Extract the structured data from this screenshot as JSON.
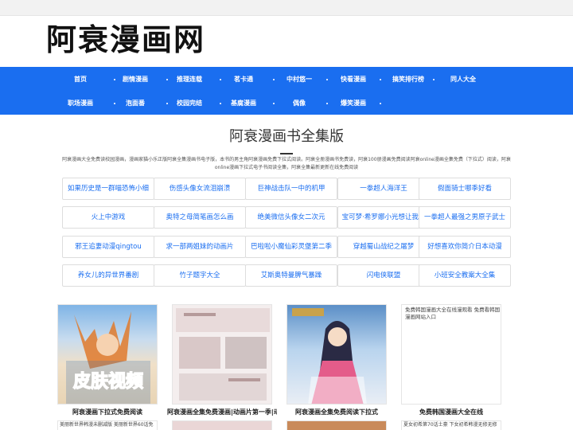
{
  "site": {
    "logo_text": "阿衰漫画网"
  },
  "nav": {
    "row1": [
      "首页",
      "剧情漫画",
      "推理连载",
      "茗卡通",
      "中村悠一",
      "快看漫画",
      "搞笑排行榜",
      "同人大全"
    ],
    "row2": [
      "职场漫画",
      "泡面番",
      "校园完结",
      "基腐漫画",
      "偶像",
      "爆笑漫画"
    ]
  },
  "hero": {
    "title": "阿衰漫画书全集版",
    "description": "阿衰漫画大全免费读校园漫画，漫画家猫小乐正版阿衰全集漫画书电子版，本书的男主角阿衰漫画免费下拉式阅读。阿衰全册漫画书免费读，阿衰100册漫画免费阅读阿衰online漫画全集免费（下拉式）阅读，阿衰online漫画下拉式电子书阅读全集，阿衰全集最新更新在线免费阅读"
  },
  "tags": [
    "如果历史是一群喵恐怖小细",
    "伤感头像女流泪崩溃",
    "巨神战击队一中的机甲",
    "一拳超人海洋王",
    "假面骑士哪季好看",
    "火上中游戏",
    "奥特之母简笔画怎么画",
    "绝美微信头像女二次元",
    "宝可梦·希罗娜小光想让我告",
    "一拳超人最强之男原子武士",
    "邪王追妻动漫qingtou",
    "求一部两姐妹的动画片",
    "巴啦啦小魔仙彩灵堡第二季",
    "穿越蜀山战纪之屠梦",
    "好想喜欢你简介日本动漫",
    "养女儿的异世界番剧",
    "竹子题字大全",
    "艾斯奥特曼脾气暴躁",
    "闪电侠联盟",
    "小班安全教案大全集"
  ],
  "cards": [
    {
      "title": "阿衰漫画下拉式免费阅读",
      "image_text": "皮肤视频"
    },
    {
      "title": "阿衰漫画全集免费漫画|动画片第一季|动…",
      "image_text": ""
    },
    {
      "title": "阿衰漫画全集免费阅读下拉式",
      "image_text": ""
    },
    {
      "title": "免费韩国漫画大全在线",
      "image_alt": "免费韩国漫画大全在线漫观看 免费看韩国漫画网站入口"
    }
  ],
  "cards_row2": [
    "美丽新世界韩漫未删减版 美丽新世界60话免",
    "",
    "",
    "夏女初希第70话土豪 下女初希韩漫无修无修"
  ],
  "colors": {
    "nav_bg": "#1a6ef0",
    "link": "#1a6ef0"
  }
}
